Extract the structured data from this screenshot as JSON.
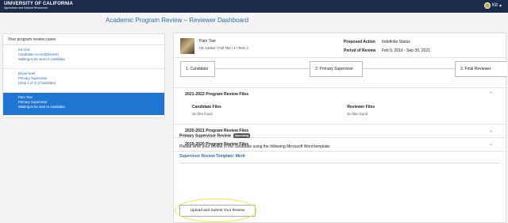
{
  "header": {
    "brand_main": "UNIVERSITY OF CALIFORNIA",
    "brand_sub": "Agriculture and Natural Resources",
    "user_name": "Kit",
    "user_menu_icon": "caret-down-icon"
  },
  "page": {
    "title": "Academic Program Review – Reviewer Dashboard"
  },
  "sidebar": {
    "title": "Your program review cases",
    "cases": [
      {
        "name": "Kit Alviz",
        "role": "Candidate Accent(Dissent)",
        "status": "Waiting to be sent to candidate"
      },
      {
        "name": "Bryan Noel",
        "role": "Primary Supervisor",
        "status": "(Step 1 of 4) (Candidate)"
      },
      {
        "name": "Pam Tise",
        "role": "Primary Supervisor",
        "status": "Waiting to be sent to candidate"
      }
    ]
  },
  "profile": {
    "name": "Pam Tise",
    "role": "CE Advisor / Full Title / 4 / Term 3",
    "proposed_action_label": "Proposed Action",
    "proposed_action_value": "Indefinite Status",
    "period_label": "Period of Review",
    "period_value": "Feb 9, 2016 - Sep 30, 2021"
  },
  "steps": [
    "1. Candidate",
    "2. Primary Supervisor",
    "3. Final Reviewer"
  ],
  "files": {
    "sections": [
      {
        "title": "2021-2022 Program Review Files",
        "expanded": true
      },
      {
        "title": "2020-2021 Program Review Files",
        "expanded": false
      },
      {
        "title": "2019-2020 Program Review Files",
        "expanded": false
      }
    ],
    "candidate_files_label": "Candidate Files",
    "reviewer_files_label": "Reviewer Files",
    "no_files": "No files found"
  },
  "review": {
    "title": "Primary Supervisor Review",
    "badge": "Upcoming",
    "instructions": "Please write your review of the candidate using the following Microsoft Word template:",
    "template_link": "Supervisor Review Template: Merit",
    "upload_button": "Upload and Submit Your Review"
  },
  "colors": {
    "header_bg": "#1a2b4c",
    "accent": "#1f76d2",
    "link": "#2c6fb3",
    "annotation": "#f1e63d"
  }
}
